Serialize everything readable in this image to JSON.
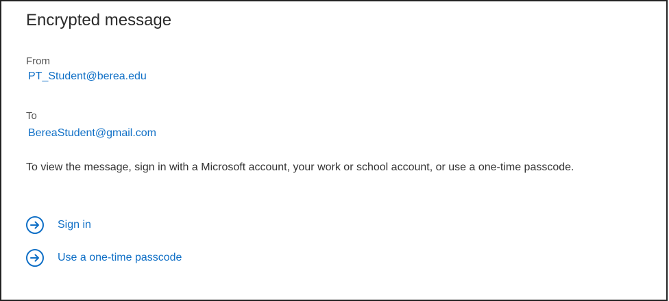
{
  "title": "Encrypted message",
  "from": {
    "label": "From",
    "address": "PT_Student@berea.edu"
  },
  "to": {
    "label": "To",
    "address": "BereaStudent@gmail.com"
  },
  "instructions": "To view the message, sign in with a Microsoft account, your work or school account, or use a one-time passcode.",
  "actions": [
    {
      "label": "Sign in",
      "icon": "arrow-right-circle-icon"
    },
    {
      "label": "Use a one-time passcode",
      "icon": "arrow-right-circle-icon"
    }
  ],
  "colors": {
    "link": "#0f6fc6",
    "text": "#333333",
    "border": "#222222"
  }
}
